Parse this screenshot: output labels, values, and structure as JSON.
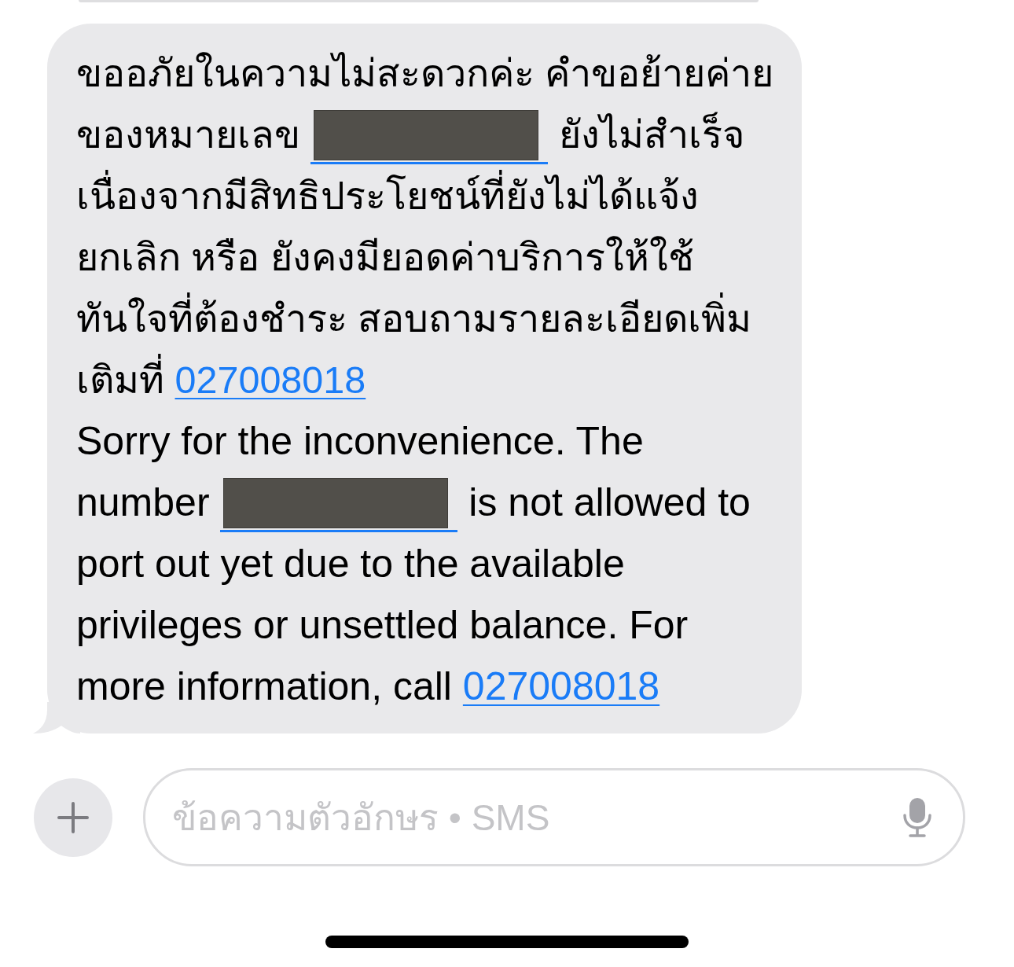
{
  "message": {
    "paragraphs": [
      {
        "kind": "thai",
        "segments": [
          {
            "kind": "text",
            "text": "ขออภัยในความไม่สะดวกค่ะ คำขอย้ายค่ายของหมายเลข "
          },
          {
            "kind": "redacted_link"
          },
          {
            "kind": "text",
            "text": " ยังไม่สำเร็จเนื่องจากมีสิทธิประโยชน์ที่ยังไม่ได้แจ้งยกเลิก หรือ ยังคงมียอดค่าบริการให้ใช้ทันใจที่ต้องชำระ สอบถามรายละเอียดเพิ่มเติมที่ "
          },
          {
            "kind": "link",
            "text": "027008018"
          }
        ]
      },
      {
        "kind": "latin",
        "segments": [
          {
            "kind": "text",
            "text": "Sorry for the inconvenience. The number "
          },
          {
            "kind": "redacted_link"
          },
          {
            "kind": "text",
            "text": " is not allowed to port out yet due to the available privileges or unsettled balance. For more information, call "
          },
          {
            "kind": "link",
            "text": "027008018"
          }
        ]
      }
    ]
  },
  "composer": {
    "placeholder": "ข้อความตัวอักษร • SMS"
  }
}
